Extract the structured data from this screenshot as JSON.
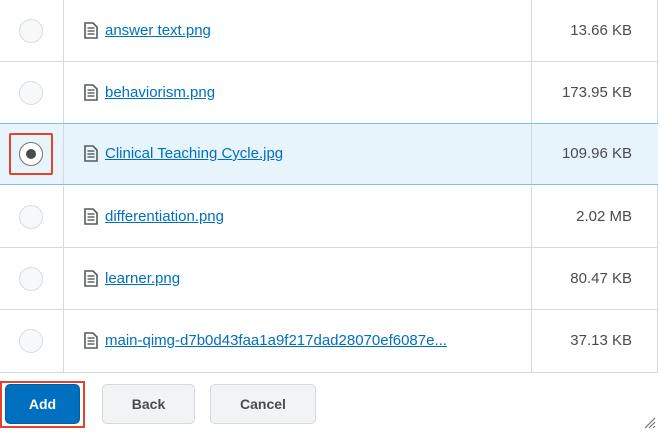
{
  "files": [
    {
      "name": "answer text.png",
      "size": "13.66 KB",
      "selected": false,
      "icon": "file-icon"
    },
    {
      "name": "behaviorism.png",
      "size": "173.95 KB",
      "selected": false,
      "icon": "file-icon"
    },
    {
      "name": "Clinical Teaching Cycle.jpg",
      "size": "109.96 KB",
      "selected": true,
      "icon": "file-icon"
    },
    {
      "name": "differentiation.png",
      "size": "2.02 MB",
      "selected": false,
      "icon": "file-icon"
    },
    {
      "name": "learner.png",
      "size": "80.47 KB",
      "selected": false,
      "icon": "file-icon"
    },
    {
      "name": "main-qimg-d7b0d43faa1a9f217dad28070ef6087e...",
      "size": "37.13 KB",
      "selected": false,
      "icon": "file-icon"
    }
  ],
  "footer": {
    "add_label": "Add",
    "back_label": "Back",
    "cancel_label": "Cancel"
  },
  "colors": {
    "accent": "#006fbf",
    "selected_row": "#e8f4fb",
    "highlight": "#e0442e"
  }
}
